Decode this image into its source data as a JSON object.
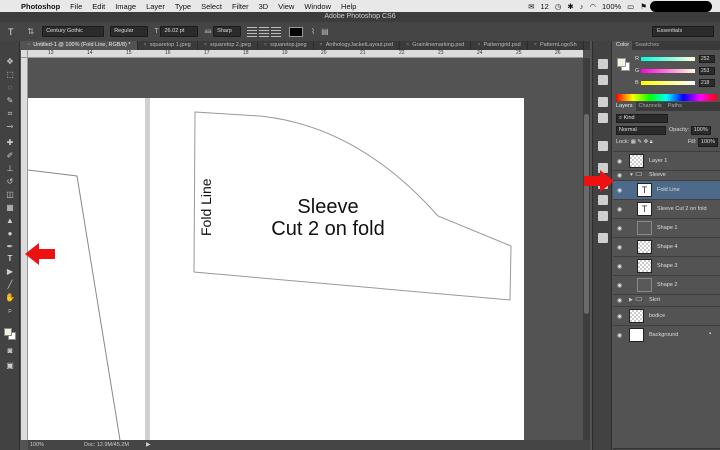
{
  "menubar": {
    "app": "Photoshop",
    "items": [
      "File",
      "Edit",
      "Image",
      "Layer",
      "Type",
      "Select",
      "Filter",
      "3D",
      "View",
      "Window",
      "Help"
    ],
    "status": {
      "notif": "12",
      "battery": "100%",
      "lang": ""
    }
  },
  "titlebar": {
    "title": "Adobe Photoshop CS6"
  },
  "options": {
    "font_family": "Century Gothic",
    "font_style": "Regular",
    "font_size": "26.02 pt",
    "anti_alias": "Sharp",
    "workspace": "Essentials",
    "text_color": "#000000"
  },
  "tabs": [
    {
      "label": "Untitled-1 @ 100% (Fold Line, RGB/8) *",
      "active": true
    },
    {
      "label": "squaretop 1.jpeg",
      "active": false
    },
    {
      "label": "squaretop 2.jpeg",
      "active": false
    },
    {
      "label": "squaretop.jpeg",
      "active": false
    },
    {
      "label": "AnthologyJacketLayout.psd",
      "active": false
    },
    {
      "label": "Grainlinemarking.psd",
      "active": false
    },
    {
      "label": "Patterngrid.psd",
      "active": false
    },
    {
      "label": "PatternLogoSh",
      "active": false
    }
  ],
  "ruler_ticks": [
    "13",
    "14",
    "15",
    "16",
    "17",
    "18",
    "19",
    "20",
    "21",
    "22",
    "23",
    "24",
    "25",
    "26"
  ],
  "canvas": {
    "sleeve_title": "Sleeve",
    "sleeve_sub": "Cut 2 on fold",
    "fold_line": "Fold Line"
  },
  "status": {
    "zoom": "100%",
    "doc": "Doc: 12.9M/45.2M",
    "arrow": "▶"
  },
  "color_panel": {
    "tabs": [
      "Color",
      "Swatches"
    ],
    "R": "252",
    "G": "253",
    "B": "218",
    "fg_color": "#f4f1df",
    "bg_color": "#ffffff"
  },
  "layers_panel": {
    "tabs": [
      "Layers",
      "Channels",
      "Paths"
    ],
    "kind": "Kind",
    "blend_mode": "Normal",
    "opacity_label": "Opacity:",
    "opacity": "100%",
    "lock_label": "Lock:",
    "fill_label": "Fill:",
    "fill": "100%",
    "layers": [
      {
        "name": "Layer 1",
        "type": "pixel",
        "indent": 0,
        "selected": false
      },
      {
        "name": "Sleeve",
        "type": "folder",
        "indent": 0,
        "selected": false
      },
      {
        "name": "Fold Line",
        "type": "text",
        "indent": 1,
        "selected": true
      },
      {
        "name": "Sleeve Cut 2 on fold",
        "type": "text",
        "indent": 1,
        "selected": false
      },
      {
        "name": "Shape 1",
        "type": "shape",
        "indent": 1,
        "selected": false
      },
      {
        "name": "Shape 4",
        "type": "pixel",
        "indent": 1,
        "selected": false
      },
      {
        "name": "Shape 3",
        "type": "pixel",
        "indent": 1,
        "selected": false
      },
      {
        "name": "Shape 2",
        "type": "shape",
        "indent": 1,
        "selected": false
      },
      {
        "name": "Skirt",
        "type": "folder",
        "indent": 0,
        "selected": false
      },
      {
        "name": "bodice",
        "type": "pixel",
        "indent": 0,
        "selected": false
      },
      {
        "name": "Background",
        "type": "white",
        "indent": 0,
        "selected": false
      }
    ]
  },
  "annotations": {
    "arrow_color": "#ee1111"
  }
}
